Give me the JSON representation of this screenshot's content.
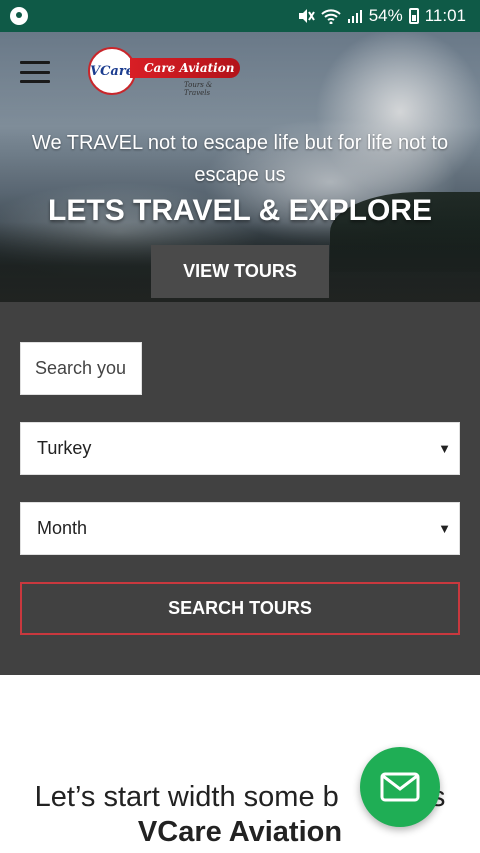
{
  "status_bar": {
    "battery": "54%",
    "time": "11:01",
    "icons": [
      "chat-icon",
      "mute-icon",
      "wifi-icon",
      "signal-icon",
      "battery-icon"
    ]
  },
  "header": {
    "menu_icon": "hamburger-menu-icon",
    "logo": {
      "circle_text": "VCare",
      "name": "Care Aviation",
      "subtitle": "Tours & Travels"
    }
  },
  "hero": {
    "tagline": "We TRAVEL not to escape life but for life not to escape us",
    "headline": "LETS TRAVEL & EXPLORE",
    "button_label": "VIEW TOURS"
  },
  "search": {
    "input_placeholder": "Search your",
    "country_value": "Turkey",
    "month_value": "Month",
    "submit_label": "SEARCH TOURS"
  },
  "intro": {
    "line1": "Let’s start width some b",
    "line1_end": "ts",
    "line2": "VCare Aviation"
  },
  "fab": {
    "icon": "mail-icon"
  },
  "colors": {
    "status_bar": "#0f5a47",
    "panel": "#414141",
    "button_dark": "#4a4a4a",
    "accent_red": "#c9383e",
    "fab_green": "#1fae55"
  }
}
